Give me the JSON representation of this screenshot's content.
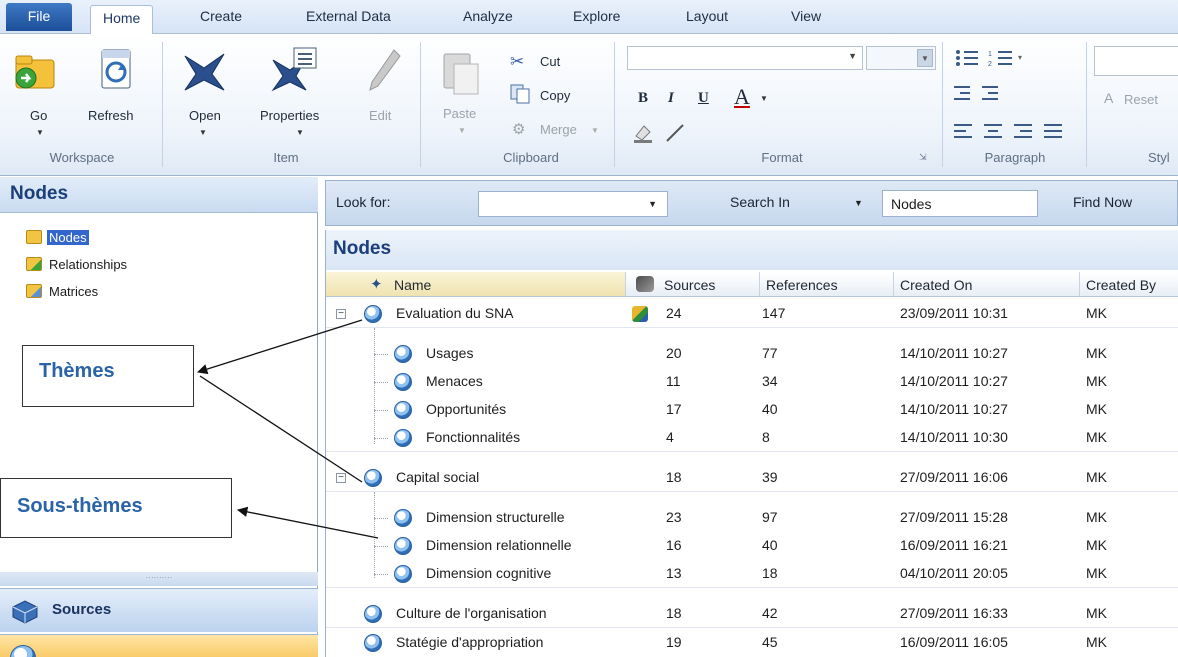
{
  "menu": {
    "tabs": [
      "File",
      "Home",
      "Create",
      "External Data",
      "Analyze",
      "Explore",
      "Layout",
      "View"
    ],
    "active": "Home"
  },
  "ribbon": {
    "workspace": {
      "label": "Workspace",
      "go": "Go",
      "refresh": "Refresh"
    },
    "item": {
      "label": "Item",
      "open": "Open",
      "properties": "Properties",
      "edit": "Edit"
    },
    "clipboard": {
      "label": "Clipboard",
      "paste": "Paste",
      "cut": "Cut",
      "copy": "Copy",
      "merge": "Merge"
    },
    "format": {
      "label": "Format",
      "bold": "B",
      "italic": "I",
      "underline": "U",
      "font_color": "A"
    },
    "paragraph": {
      "label": "Paragraph"
    },
    "styles": {
      "label": "Styl",
      "reset": "Reset"
    }
  },
  "left": {
    "title": "Nodes",
    "tree": [
      "Nodes",
      "Relationships",
      "Matrices"
    ],
    "sources_button": "Sources"
  },
  "search": {
    "look_for": "Look for:",
    "search_in": "Search In",
    "scope": "Nodes",
    "find_now": "Find Now"
  },
  "nodes": {
    "title": "Nodes",
    "columns": [
      "Name",
      "Sources",
      "References",
      "Created On",
      "Created By"
    ],
    "rows": [
      {
        "name": "Evaluation du SNA",
        "sources": "24",
        "refs": "147",
        "created": "23/09/2011 10:31",
        "by": "MK"
      },
      {
        "name": "Usages",
        "sources": "20",
        "refs": "77",
        "created": "14/10/2011 10:27",
        "by": "MK"
      },
      {
        "name": "Menaces",
        "sources": "11",
        "refs": "34",
        "created": "14/10/2011 10:27",
        "by": "MK"
      },
      {
        "name": "Opportunités",
        "sources": "17",
        "refs": "40",
        "created": "14/10/2011 10:27",
        "by": "MK"
      },
      {
        "name": "Fonctionnalités",
        "sources": "4",
        "refs": "8",
        "created": "14/10/2011 10:30",
        "by": "MK"
      },
      {
        "name": "Capital social",
        "sources": "18",
        "refs": "39",
        "created": "27/09/2011 16:06",
        "by": "MK"
      },
      {
        "name": "Dimension structurelle",
        "sources": "23",
        "refs": "97",
        "created": "27/09/2011 15:28",
        "by": "MK"
      },
      {
        "name": "Dimension relationnelle",
        "sources": "16",
        "refs": "40",
        "created": "16/09/2011 16:21",
        "by": "MK"
      },
      {
        "name": "Dimension cognitive",
        "sources": "13",
        "refs": "18",
        "created": "04/10/2011 20:05",
        "by": "MK"
      },
      {
        "name": "Culture de l'organisation",
        "sources": "18",
        "refs": "42",
        "created": "27/09/2011 16:33",
        "by": "MK"
      },
      {
        "name": "Statégie d'appropriation",
        "sources": "19",
        "refs": "45",
        "created": "16/09/2011 16:05",
        "by": "MK"
      }
    ]
  },
  "annotations": {
    "themes": "Thèmes",
    "subthemes": "Sous-thèmes"
  },
  "colors": {
    "accent": "#1a3f7a",
    "annotation_text": "#2a63a8",
    "selection": "#3366cc"
  }
}
